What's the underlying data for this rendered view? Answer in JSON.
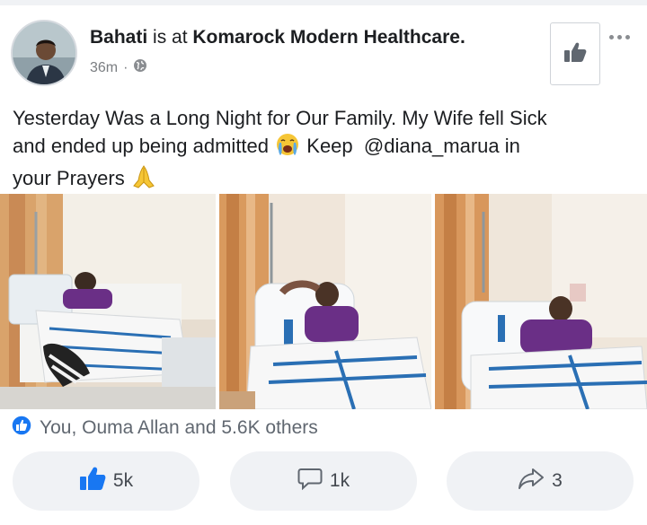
{
  "post": {
    "author_name": "Bahati",
    "checkin_text": " is at ",
    "place": "Komarock Modern Healthcare.",
    "time": "36m",
    "time_sep": "·",
    "privacy_icon": "globe-icon",
    "text_line1": "Yesterday Was a Long Night for Our Family. My Wife fell Sick",
    "text_line2a": "and ended up being admitted",
    "text_line2b": "Keep  @diana_marua in",
    "text_line3": "your Prayers"
  },
  "reactions": {
    "summary": "You, Ouma Allan and 5.6K others",
    "icon": "like-reaction-icon"
  },
  "actions": {
    "like_count": "5k",
    "comment_count": "1k",
    "share_count": "3"
  },
  "colors": {
    "brand_blue": "#1877f2",
    "button_bg": "#f0f2f5",
    "muted_text": "#606770"
  }
}
